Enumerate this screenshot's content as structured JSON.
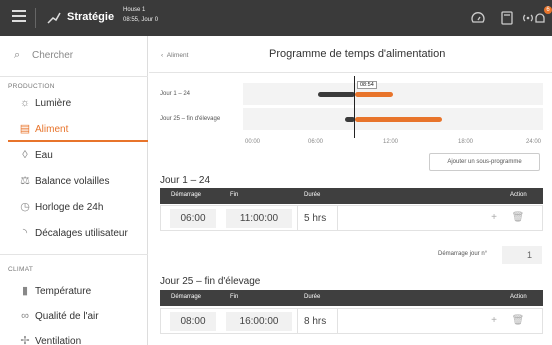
{
  "topbar": {
    "title": "Stratégie",
    "house": "House 1",
    "time_day": "08:55, Jour 0",
    "badge_count": "6"
  },
  "sidebar": {
    "search_placeholder": "Chercher",
    "section_production": "PRODUCTION",
    "items_production": [
      {
        "label": "Lumière",
        "icon": "bulb-icon"
      },
      {
        "label": "Aliment",
        "icon": "feed-icon"
      },
      {
        "label": "Eau",
        "icon": "drop-icon"
      },
      {
        "label": "Balance volailles",
        "icon": "scale-icon"
      },
      {
        "label": "Horloge de 24h",
        "icon": "clock-icon"
      },
      {
        "label": "Décalages utilisateur",
        "icon": "offset-icon"
      }
    ],
    "section_climat": "CLIMAT",
    "items_climat": [
      {
        "label": "Température",
        "icon": "thermometer-icon"
      },
      {
        "label": "Qualité de l'air",
        "icon": "air-quality-icon"
      },
      {
        "label": "Ventilation",
        "icon": "fan-icon"
      }
    ]
  },
  "main": {
    "back_label": "Aliment",
    "page_title": "Programme de temps d'alimentation",
    "gantt": {
      "rows": [
        "Jour 1 – 24",
        "Jour 25 – fin d'élevage"
      ],
      "ticks": [
        "00:00",
        "06:00",
        "12:00",
        "18:00",
        "24:00"
      ],
      "now_label": "08:54"
    },
    "add_subprogram": "Ajouter un sous-programme",
    "program1": {
      "title": "Jour 1 – 24",
      "headers": {
        "start": "Démarrage",
        "end": "Fin",
        "duration": "Durée",
        "action": "Action"
      },
      "start": "06:00",
      "end": "11:00:00",
      "duration": "5 hrs"
    },
    "start_day_label": "Démarrage jour n°",
    "start_day_value": "1",
    "program2": {
      "title": "Jour 25 – fin d'élevage",
      "headers": {
        "start": "Démarrage",
        "end": "Fin",
        "duration": "Durée",
        "action": "Action"
      },
      "start": "08:00",
      "end": "16:00:00",
      "duration": "8 hrs"
    }
  },
  "colors": {
    "accent": "#e8742b",
    "dark_bar": "#3a3a3a"
  }
}
